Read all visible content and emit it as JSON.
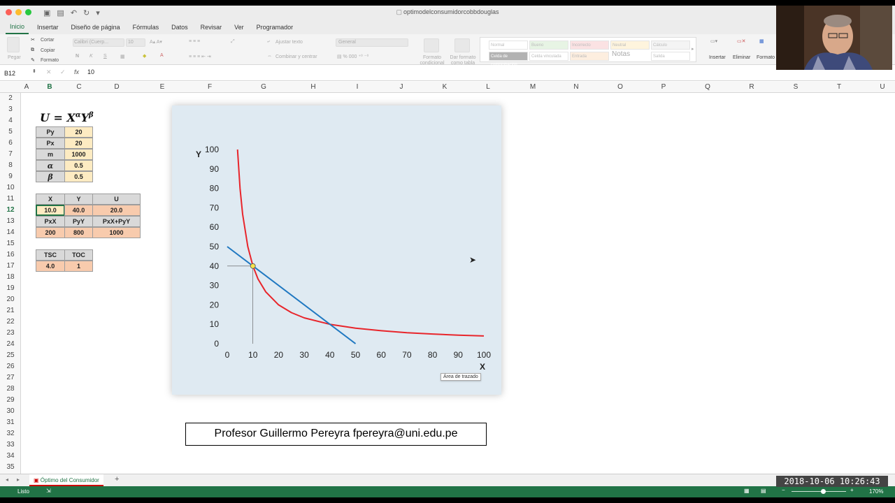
{
  "window": {
    "title": "optimodelconsumidorcobbdouglas"
  },
  "tabs": [
    "Inicio",
    "Insertar",
    "Diseño de página",
    "Fórmulas",
    "Datos",
    "Revisar",
    "Ver",
    "Programador"
  ],
  "ribbon": {
    "paste": "Pegar",
    "cut": "Cortar",
    "copy": "Copiar",
    "format": "Formato",
    "font": "Calibri (Cuerp...",
    "size": "10",
    "wrap": "Ajustar texto",
    "merge": "Combinar y centrar",
    "number": "General",
    "cond_format": "Formato condicional",
    "table_format": "Dar formato como tabla",
    "styles": [
      "Normal",
      "Bueno",
      "Incorrecto",
      "Neutral",
      "Cálculo",
      "Celda de comprobación",
      "Celda vinculada",
      "Entrada",
      "Notas",
      "Salida"
    ],
    "insert": "Insertar",
    "delete": "Eliminar",
    "format_cells": "Formato"
  },
  "formula_bar": {
    "cell": "B12",
    "fx": "fx",
    "value": "10"
  },
  "columns": [
    "A",
    "B",
    "C",
    "D",
    "E",
    "F",
    "G",
    "H",
    "I",
    "J",
    "K",
    "L",
    "M",
    "N",
    "O",
    "P",
    "Q",
    "R",
    "S",
    "T",
    "U"
  ],
  "rows": [
    "2",
    "3",
    "4",
    "5",
    "6",
    "7",
    "8",
    "9",
    "10",
    "11",
    "12",
    "13",
    "14",
    "15",
    "16",
    "17",
    "18",
    "19",
    "20",
    "21",
    "22",
    "23",
    "24",
    "25",
    "26",
    "27",
    "28",
    "29",
    "30",
    "31",
    "32",
    "33",
    "34",
    "35"
  ],
  "sheet": {
    "formula_parts": {
      "u": "U",
      "eq": " = X",
      "alpha": "α",
      "y": "Y",
      "beta": "β"
    },
    "params": [
      {
        "label": "Py",
        "value": "20"
      },
      {
        "label": "Px",
        "value": "20"
      },
      {
        "label": "m",
        "value": "1000"
      },
      {
        "label": "α",
        "value": "0.5"
      },
      {
        "label": "β",
        "value": "0.5"
      }
    ],
    "opt_headers": [
      "X",
      "Y",
      "U"
    ],
    "opt_values": [
      "10.0",
      "40.0",
      "20.0"
    ],
    "cost_headers": [
      "PxX",
      "PyY",
      "PxX+PyY"
    ],
    "cost_values": [
      "200",
      "800",
      "1000"
    ],
    "rate_headers": [
      "TSC",
      "TOC"
    ],
    "rate_values": [
      "4.0",
      "1"
    ]
  },
  "chart_data": {
    "type": "line",
    "xlabel": "X",
    "ylabel": "Y",
    "xlim": [
      0,
      100
    ],
    "ylim": [
      0,
      100
    ],
    "xticks": [
      0,
      10,
      20,
      30,
      40,
      50,
      60,
      70,
      80,
      90,
      100
    ],
    "yticks": [
      0,
      10,
      20,
      30,
      40,
      50,
      60,
      70,
      80,
      90,
      100
    ],
    "series": [
      {
        "color": "#e8252b",
        "x": [
          4,
          5,
          6,
          8,
          10,
          12,
          15,
          20,
          25,
          30,
          40,
          50,
          60,
          70,
          80,
          90,
          100
        ],
        "y": [
          100,
          80,
          66.7,
          50,
          40,
          33.3,
          26.7,
          20,
          16,
          13.3,
          10,
          8,
          6.7,
          5.7,
          5,
          4.4,
          4
        ]
      },
      {
        "color": "#1f78c1",
        "x": [
          0,
          50
        ],
        "y": [
          50,
          0
        ]
      }
    ],
    "optimum": {
      "x": 10,
      "y": 40
    },
    "tooltip": "Área de trazado"
  },
  "credit": "Profesor Guillermo Pereyra fpereyra@uni.edu.pe",
  "sheet_tab": "Óptimo del Consumidor",
  "status": {
    "ready": "Listo",
    "zoom": "170%"
  },
  "timestamp": "2018-10-06  10:26:43"
}
